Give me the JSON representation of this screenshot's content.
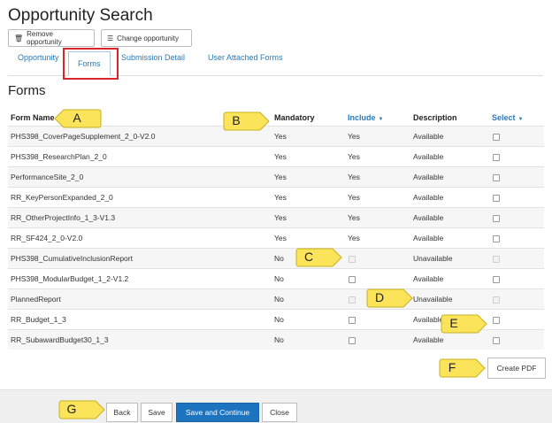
{
  "page": {
    "title": "Opportunity Search"
  },
  "toolbar": {
    "remove_label": "Remove opportunity",
    "change_label": "Change opportunity",
    "remove_icon": "trash-icon",
    "change_icon": "list-icon"
  },
  "tabs": [
    {
      "label": "Opportunity"
    },
    {
      "label": "Forms"
    },
    {
      "label": "Submission Detail"
    },
    {
      "label": "User Attached Forms"
    }
  ],
  "section": {
    "title": "Forms"
  },
  "columns": {
    "form_name": "Form Name",
    "mandatory": "Mandatory",
    "include": "Include",
    "description": "Description",
    "select": "Select"
  },
  "rows": [
    {
      "name": "PHS398_CoverPageSupplement_2_0-V2.0",
      "mandatory": "Yes",
      "include": "Yes",
      "description": "Available"
    },
    {
      "name": "PHS398_ResearchPlan_2_0",
      "mandatory": "Yes",
      "include": "Yes",
      "description": "Available"
    },
    {
      "name": "PerformanceSite_2_0",
      "mandatory": "Yes",
      "include": "Yes",
      "description": "Available"
    },
    {
      "name": "RR_KeyPersonExpanded_2_0",
      "mandatory": "Yes",
      "include": "Yes",
      "description": "Available"
    },
    {
      "name": "RR_OtherProjectInfo_1_3-V1.3",
      "mandatory": "Yes",
      "include": "Yes",
      "description": "Available"
    },
    {
      "name": "RR_SF424_2_0-V2.0",
      "mandatory": "Yes",
      "include": "Yes",
      "description": "Available"
    },
    {
      "name": "PHS398_CumulativeInclusionReport",
      "mandatory": "No",
      "include": "",
      "description": "Unavailable"
    },
    {
      "name": "PHS398_ModularBudget_1_2-V1.2",
      "mandatory": "No",
      "include": "",
      "description": "Available"
    },
    {
      "name": "PlannedReport",
      "mandatory": "No",
      "include": "",
      "description": "Unavailable"
    },
    {
      "name": "RR_Budget_1_3",
      "mandatory": "No",
      "include": "",
      "description": "Available"
    },
    {
      "name": "RR_SubawardBudget30_1_3",
      "mandatory": "No",
      "include": "",
      "description": "Available"
    }
  ],
  "create_pdf": "Create PDF",
  "footer": {
    "back": "Back",
    "save": "Save",
    "save_continue": "Save and Continue",
    "close": "Close"
  },
  "callouts": [
    "A",
    "B",
    "C",
    "D",
    "E",
    "F",
    "G"
  ],
  "colors": {
    "link": "#2a7ab8",
    "primary": "#1e73be",
    "highlight": "#d9262b",
    "callout": "#fbe35a"
  }
}
